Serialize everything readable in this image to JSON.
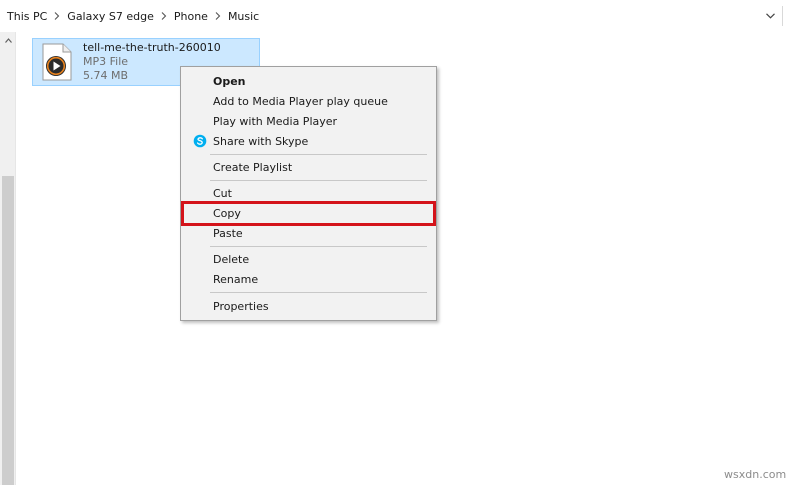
{
  "address_bar": {
    "crumbs": [
      "This PC",
      "Galaxy S7 edge",
      "Phone",
      "Music"
    ]
  },
  "file": {
    "name": "tell-me-the-truth-260010",
    "type": "MP3 File",
    "size": "5.74 MB"
  },
  "context_menu": {
    "items": [
      {
        "label": "Open",
        "bold": true
      },
      {
        "label": "Add to Media Player play queue"
      },
      {
        "label": "Play with Media Player"
      },
      {
        "label": "Share with Skype",
        "icon": "skype-icon"
      },
      {
        "label": "Create Playlist"
      },
      {
        "label": "Cut"
      },
      {
        "label": "Copy",
        "highlighted": true
      },
      {
        "label": "Paste"
      },
      {
        "label": "Delete"
      },
      {
        "label": "Rename"
      },
      {
        "label": "Properties"
      }
    ]
  },
  "colors": {
    "selection_bg": "#cce8ff",
    "selection_border": "#99d1ff",
    "highlight_border": "#d4141b",
    "skype_blue": "#00aff0"
  },
  "watermark": "wsxdn.com"
}
